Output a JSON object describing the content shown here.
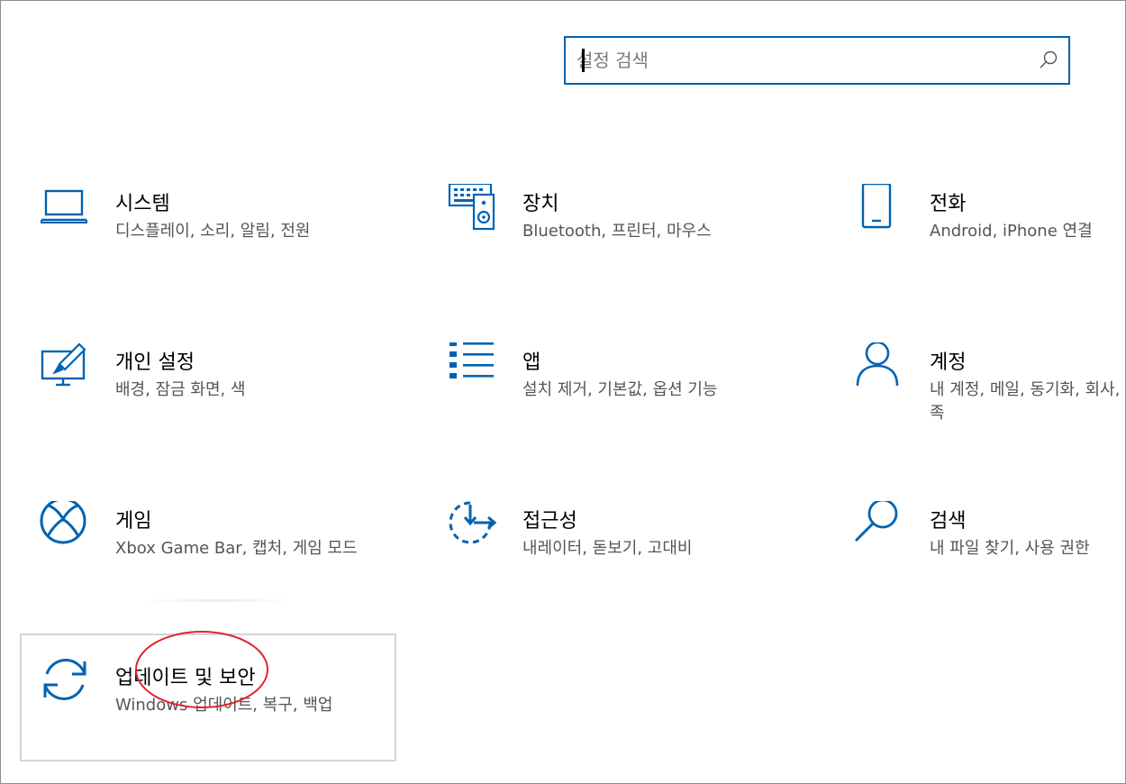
{
  "search": {
    "placeholder": "설정 검색"
  },
  "tiles": [
    {
      "title": "시스템",
      "desc": "디스플레이, 소리, 알림, 전원",
      "icon": "laptop-icon"
    },
    {
      "title": "장치",
      "desc": "Bluetooth, 프린터, 마우스",
      "icon": "devices-icon"
    },
    {
      "title": "전화",
      "desc": "Android, iPhone 연결",
      "icon": "phone-icon"
    },
    {
      "title": "개인 설정",
      "desc": "배경, 잠금 화면, 색",
      "icon": "personalization-icon"
    },
    {
      "title": "앱",
      "desc": "설치 제거, 기본값, 옵션 기능",
      "icon": "apps-list-icon"
    },
    {
      "title": "계정",
      "desc": "내 계정, 메일, 동기화, 회사, 가족",
      "icon": "person-icon"
    },
    {
      "title": "게임",
      "desc": "Xbox Game Bar, 캡처, 게임 모드",
      "icon": "xbox-icon"
    },
    {
      "title": "접근성",
      "desc": "내레이터, 돋보기, 고대비",
      "icon": "ease-of-access-icon"
    },
    {
      "title": "검색",
      "desc": "내 파일 찾기, 사용 권한",
      "icon": "magnifier-icon"
    },
    {
      "title": "업데이트 및 보안",
      "desc": "Windows 업데이트, 복구, 백업",
      "icon": "sync-arrows-icon"
    }
  ],
  "colors": {
    "accent": "#0063b1",
    "annotation": "#e0242b"
  }
}
